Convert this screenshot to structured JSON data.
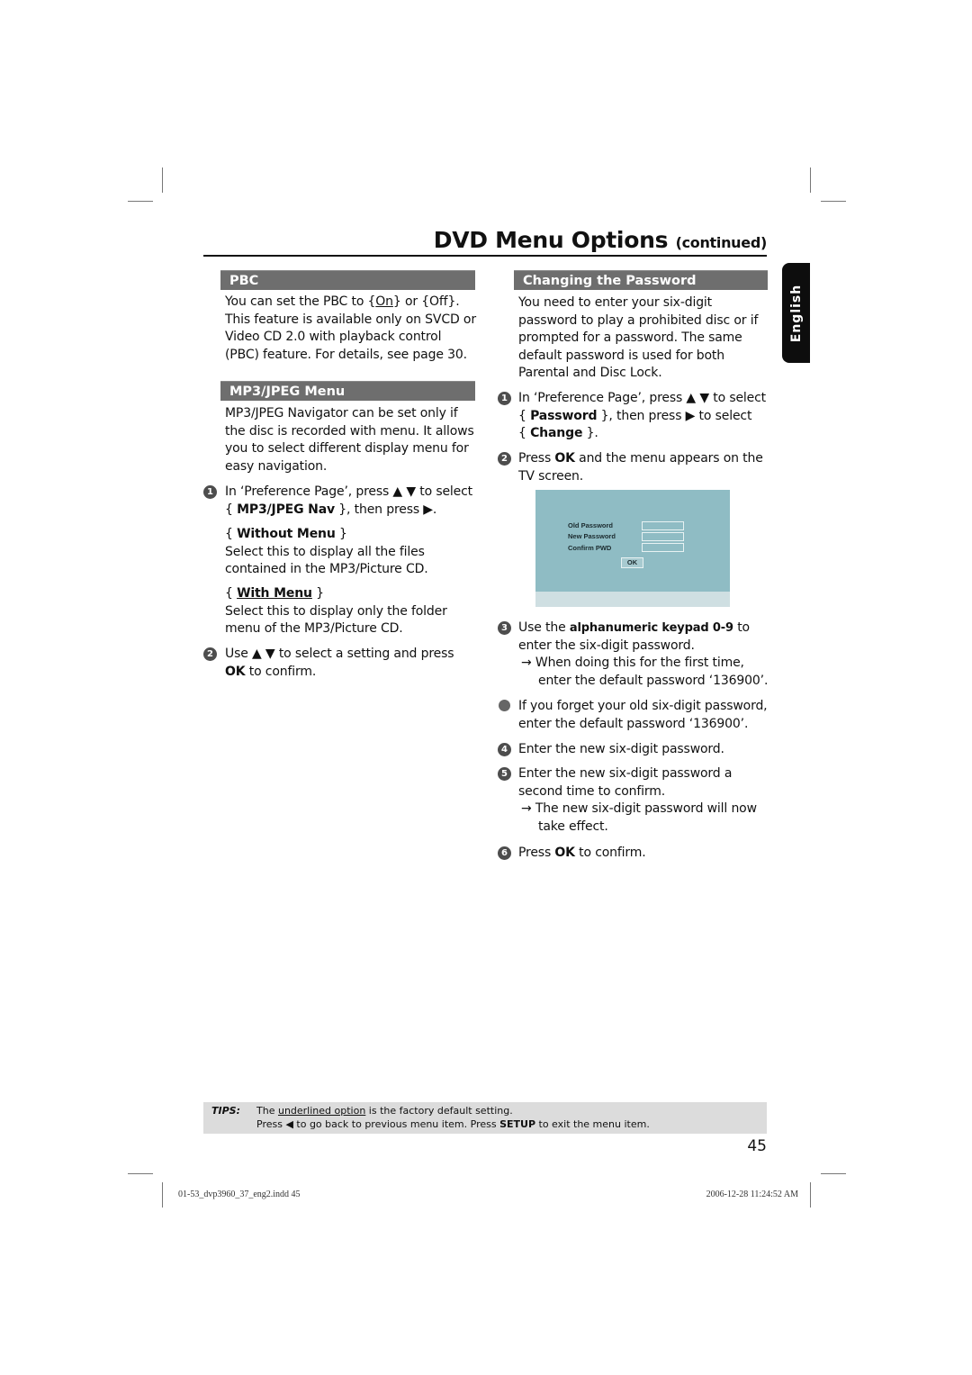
{
  "header": {
    "title": "DVD Menu Options",
    "title_suffix": "(continued)"
  },
  "language_tab": "English",
  "left_column": {
    "pbc": {
      "heading": "PBC",
      "lines": [
        [
          "You can set the PBC to {",
          "On",
          "} or {Off}."
        ],
        "This feature is available only on SVCD or",
        "Video CD 2.0 with playback control",
        "(PBC) feature. For details, see page 30."
      ]
    },
    "mp3": {
      "heading": "MP3/JPEG Menu",
      "intro": [
        "MP3/JPEG Navigator can be set only if",
        "the disc is recorded with menu. It allows",
        "you to select different display menu for",
        "easy navigation."
      ],
      "step1": {
        "number": "1",
        "line1": "In ‘Preference Page’, press ▲ ▼ to select",
        "line2_pre": "{ ",
        "line2_bold": "MP3/JPEG Nav",
        "line2_post": " }, then press ▶."
      },
      "option_without": {
        "label": "Without Menu",
        "desc": [
          "Select this to display all the files",
          "contained in the MP3/Picture CD."
        ]
      },
      "option_with": {
        "label": "With Menu",
        "desc": [
          "Select this to display only the folder",
          "menu of the MP3/Picture CD."
        ]
      },
      "step2": {
        "number": "2",
        "line1": "Use ▲ ▼ to select a setting and press",
        "line2_bold": "OK",
        "line2_post": " to confirm."
      }
    }
  },
  "right_column": {
    "heading": "Changing the Password",
    "intro": [
      "You need to enter your six-digit",
      "password to play a prohibited disc or if",
      "prompted for a password. The same",
      "default password is used for both",
      "Parental and Disc Lock."
    ],
    "step1": {
      "number": "1",
      "line1": "In ‘Preference Page’, press ▲ ▼ to select",
      "line2_bold": "Password",
      "line2_post": " }, then press ▶ to select",
      "line3_bold": "Change"
    },
    "step2": {
      "number": "2",
      "pre": "Press ",
      "bold": "OK",
      "post": " and the menu appears on the",
      "line2": "TV screen."
    },
    "tv_screen": {
      "fields": [
        "Old  Password",
        "New Password",
        "Confirm PWD"
      ],
      "ok_button": "OK",
      "background": "#8fbcc4"
    },
    "step3": {
      "number": "3",
      "pre": "Use the ",
      "bold": "alphanumeric keypad 0-9",
      "post": " to",
      "line2": "enter the six-digit password.",
      "result1": "→ When doing this for the first time,",
      "result2": "enter the default password ‘136900’."
    },
    "bullet": {
      "line1": "If you forget your old six-digit password,",
      "line2": "enter the default password ‘136900’."
    },
    "step4": {
      "number": "4",
      "text": "Enter the new six-digit password."
    },
    "step5": {
      "number": "5",
      "line1": "Enter the new six-digit password a",
      "line2": "second time to confirm.",
      "result1": "→ The new six-digit password will now",
      "result2": "take effect."
    },
    "step6": {
      "number": "6",
      "pre": "Press ",
      "bold": "OK",
      "post": " to confirm."
    }
  },
  "tips": {
    "label": "TIPS:",
    "line1_pre": "The ",
    "line1_u": "underlined option",
    "line1_post": " is the factory default setting.",
    "line2_pre": "Press  ◀ to go back to previous menu item. Press ",
    "line2_bold": "SETUP",
    "line2_post": " to exit the menu item."
  },
  "page_number": "45",
  "slug": {
    "file": "01-53_dvp3960_37_eng2.indd   45",
    "timestamp": "2006-12-28   11:24:52 AM"
  }
}
